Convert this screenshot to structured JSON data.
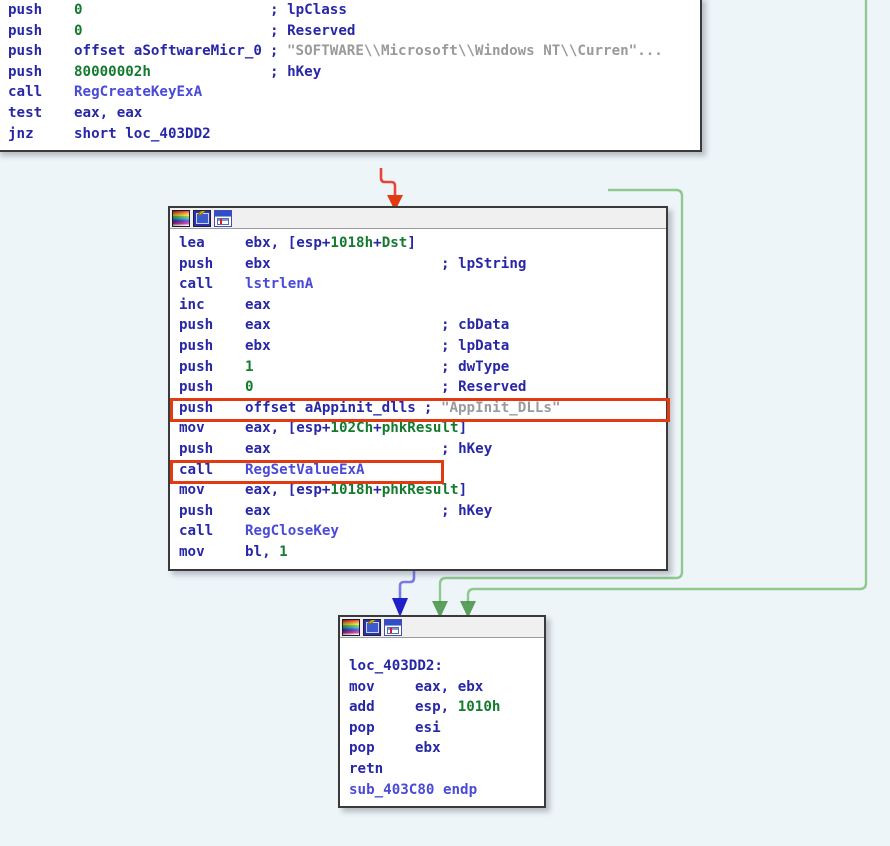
{
  "app": {
    "view": "IDA Pro graph view",
    "background_color": "#eef5f9",
    "accent_colors": {
      "mnemonic": "#2727a8",
      "number": "#137a2e",
      "name": "#4a4ad8",
      "string": "#9a9a9a",
      "highlight": "#e23a12",
      "edge_red": "#e8453a",
      "edge_green": "#8fc98f",
      "edge_blue": "#3a3ad0"
    }
  },
  "toolbar_icons": [
    {
      "name": "palette-icon",
      "label": "colors"
    },
    {
      "name": "edit-icon",
      "label": "edit"
    },
    {
      "name": "graph-icon",
      "label": "graph-overview"
    }
  ],
  "blocks": [
    {
      "id": "block-top",
      "name": "basic-block-regcreatekeyexa",
      "has_titlebar": false,
      "instructions": [
        {
          "mnemonic": "push",
          "operands": "0",
          "operand_num": "0",
          "comment": "; lpClass"
        },
        {
          "mnemonic": "push",
          "operands": "0",
          "operand_num": "0",
          "comment": "; Reserved"
        },
        {
          "mnemonic": "push",
          "operands": "offset aSoftwareMicr_0",
          "comment": "; ",
          "string": "\"SOFTWARE\\\\Microsoft\\\\Windows NT\\\\Curren\"..."
        },
        {
          "mnemonic": "push",
          "operands": "80000002h",
          "operand_num": "80000002h",
          "comment": "; hKey"
        },
        {
          "mnemonic": "call",
          "operands": "RegCreateKeyExA",
          "operand_name": "RegCreateKeyExA",
          "comment": ""
        },
        {
          "mnemonic": "test",
          "operands": "eax, eax",
          "comment": ""
        },
        {
          "mnemonic": "jnz",
          "operands": "short loc_403DD2",
          "comment": ""
        }
      ]
    },
    {
      "id": "block-middle",
      "name": "basic-block-regsetvalueexa",
      "has_titlebar": true,
      "instructions": [
        {
          "mnemonic": "lea",
          "operands": "ebx, [esp+1018h+Dst]",
          "comment": ""
        },
        {
          "mnemonic": "push",
          "operands": "ebx",
          "comment": "; lpString"
        },
        {
          "mnemonic": "call",
          "operands": "lstrlenA",
          "operand_name": "lstrlenA",
          "comment": ""
        },
        {
          "mnemonic": "inc",
          "operands": "eax",
          "comment": ""
        },
        {
          "mnemonic": "push",
          "operands": "eax",
          "comment": "; cbData"
        },
        {
          "mnemonic": "push",
          "operands": "ebx",
          "comment": "; lpData"
        },
        {
          "mnemonic": "push",
          "operands": "1",
          "operand_num": "1",
          "comment": "; dwType"
        },
        {
          "mnemonic": "push",
          "operands": "0",
          "operand_num": "0",
          "comment": "; Reserved"
        },
        {
          "mnemonic": "push",
          "operands": "offset aAppinit_dlls",
          "comment": "; ",
          "string": "\"AppInit_DLLs\"",
          "highlighted": true
        },
        {
          "mnemonic": "mov",
          "operands": "eax, [esp+102Ch+phkResult]",
          "comment": ""
        },
        {
          "mnemonic": "push",
          "operands": "eax",
          "comment": "; hKey"
        },
        {
          "mnemonic": "call",
          "operands": "RegSetValueExA",
          "operand_name": "RegSetValueExA",
          "comment": "",
          "highlighted": true
        },
        {
          "mnemonic": "mov",
          "operands": "eax, [esp+1018h+phkResult]",
          "comment": ""
        },
        {
          "mnemonic": "push",
          "operands": "eax",
          "comment": "; hKey"
        },
        {
          "mnemonic": "call",
          "operands": "RegCloseKey",
          "operand_name": "RegCloseKey",
          "comment": ""
        },
        {
          "mnemonic": "mov",
          "operands": "bl, 1",
          "comment": ""
        }
      ]
    },
    {
      "id": "block-bottom",
      "name": "basic-block-epilogue",
      "has_titlebar": true,
      "label": "loc_403DD2:",
      "instructions": [
        {
          "mnemonic": "mov",
          "operands": "eax, ebx",
          "comment": ""
        },
        {
          "mnemonic": "add",
          "operands": "esp, 1010h",
          "operand_num": "1010h",
          "comment": ""
        },
        {
          "mnemonic": "pop",
          "operands": "esi",
          "comment": ""
        },
        {
          "mnemonic": "pop",
          "operands": "ebx",
          "comment": ""
        },
        {
          "mnemonic": "retn",
          "operands": "",
          "comment": ""
        }
      ],
      "footer": "sub_403C80 endp"
    }
  ],
  "highlight_boxes": [
    {
      "name": "highlight-appinit-dlls-push",
      "target": "push offset aAppinit_dlls ; \"AppInit_DLLs\""
    },
    {
      "name": "highlight-regsetvalueexa-call",
      "target": "call RegSetValueExA"
    }
  ],
  "edges": [
    {
      "name": "edge-top-to-middle",
      "color": "#e8453a",
      "from": "block-top",
      "to": "block-middle",
      "kind": "false-branch"
    },
    {
      "name": "edge-top-to-bottom-right",
      "color": "#8fc98f",
      "from": "block-top",
      "to": "block-bottom",
      "kind": "true-branch"
    },
    {
      "name": "edge-middle-to-bottom",
      "color": "#3a3ad0",
      "from": "block-middle",
      "to": "block-bottom",
      "kind": "fallthrough"
    },
    {
      "name": "edge-outer-to-bottom",
      "color": "#8fc98f",
      "from": "offscreen",
      "to": "block-bottom",
      "kind": "true-branch"
    }
  ]
}
